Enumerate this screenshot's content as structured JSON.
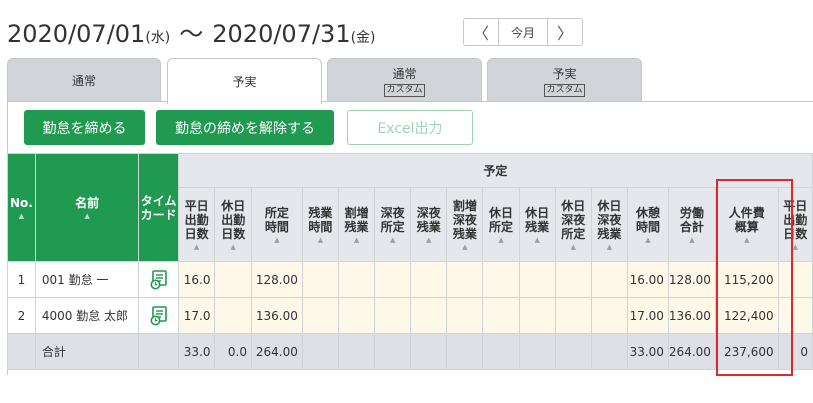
{
  "header": {
    "start_date": "2020/07/01",
    "start_dow": "(水)",
    "tilde": "〜",
    "end_date": "2020/07/31",
    "end_dow": "(金)",
    "prev_symbol": "〈",
    "next_symbol": "〉",
    "this_month_label": "今月"
  },
  "tabs": [
    {
      "label": "通常",
      "sub": ""
    },
    {
      "label": "予実",
      "sub": ""
    },
    {
      "label": "通常",
      "sub": "カスタム"
    },
    {
      "label": "予実",
      "sub": "カスタム"
    }
  ],
  "active_tab_index": 1,
  "toolbar": {
    "close_button": "勤怠を締める",
    "unclose_button": "勤怠の締めを解除する",
    "excel_button": "Excel出力"
  },
  "table": {
    "group_header": "予定",
    "col_no": "No.",
    "col_name": "名前",
    "col_timecard": [
      "タイム",
      "カード"
    ],
    "columns": [
      [
        "平日",
        "出勤",
        "日数"
      ],
      [
        "休日",
        "出勤",
        "日数"
      ],
      [
        "所定",
        "時間"
      ],
      [
        "残業",
        "時間"
      ],
      [
        "割増",
        "残業"
      ],
      [
        "深夜",
        "所定"
      ],
      [
        "深夜",
        "残業"
      ],
      [
        "割増",
        "深夜",
        "残業"
      ],
      [
        "休日",
        "所定"
      ],
      [
        "休日",
        "残業"
      ],
      [
        "休日",
        "深夜",
        "所定"
      ],
      [
        "休日",
        "深夜",
        "残業"
      ],
      [
        "休憩",
        "時間"
      ],
      [
        "労働",
        "合計"
      ],
      [
        "人件費",
        "概算"
      ],
      [
        "平日",
        "出勤",
        "日数"
      ]
    ],
    "rows": [
      {
        "no": "1",
        "name": "001 勤怠 一",
        "values": [
          "16.0",
          "",
          "128.00",
          "",
          "",
          "",
          "",
          "",
          "",
          "",
          "",
          "",
          "16.00",
          "128.00",
          "115,200",
          ""
        ]
      },
      {
        "no": "2",
        "name": "4000 勤怠 太郎",
        "values": [
          "17.0",
          "",
          "136.00",
          "",
          "",
          "",
          "",
          "",
          "",
          "",
          "",
          "",
          "17.00",
          "136.00",
          "122,400",
          ""
        ]
      }
    ],
    "total": {
      "label": "合計",
      "values": [
        "33.0",
        "0.0",
        "264.00",
        "",
        "",
        "",
        "",
        "",
        "",
        "",
        "",
        "",
        "33.00",
        "264.00",
        "237,600",
        "0"
      ]
    }
  },
  "colors": {
    "accent_green": "#1f9a50",
    "highlight_red": "#e0272b"
  }
}
